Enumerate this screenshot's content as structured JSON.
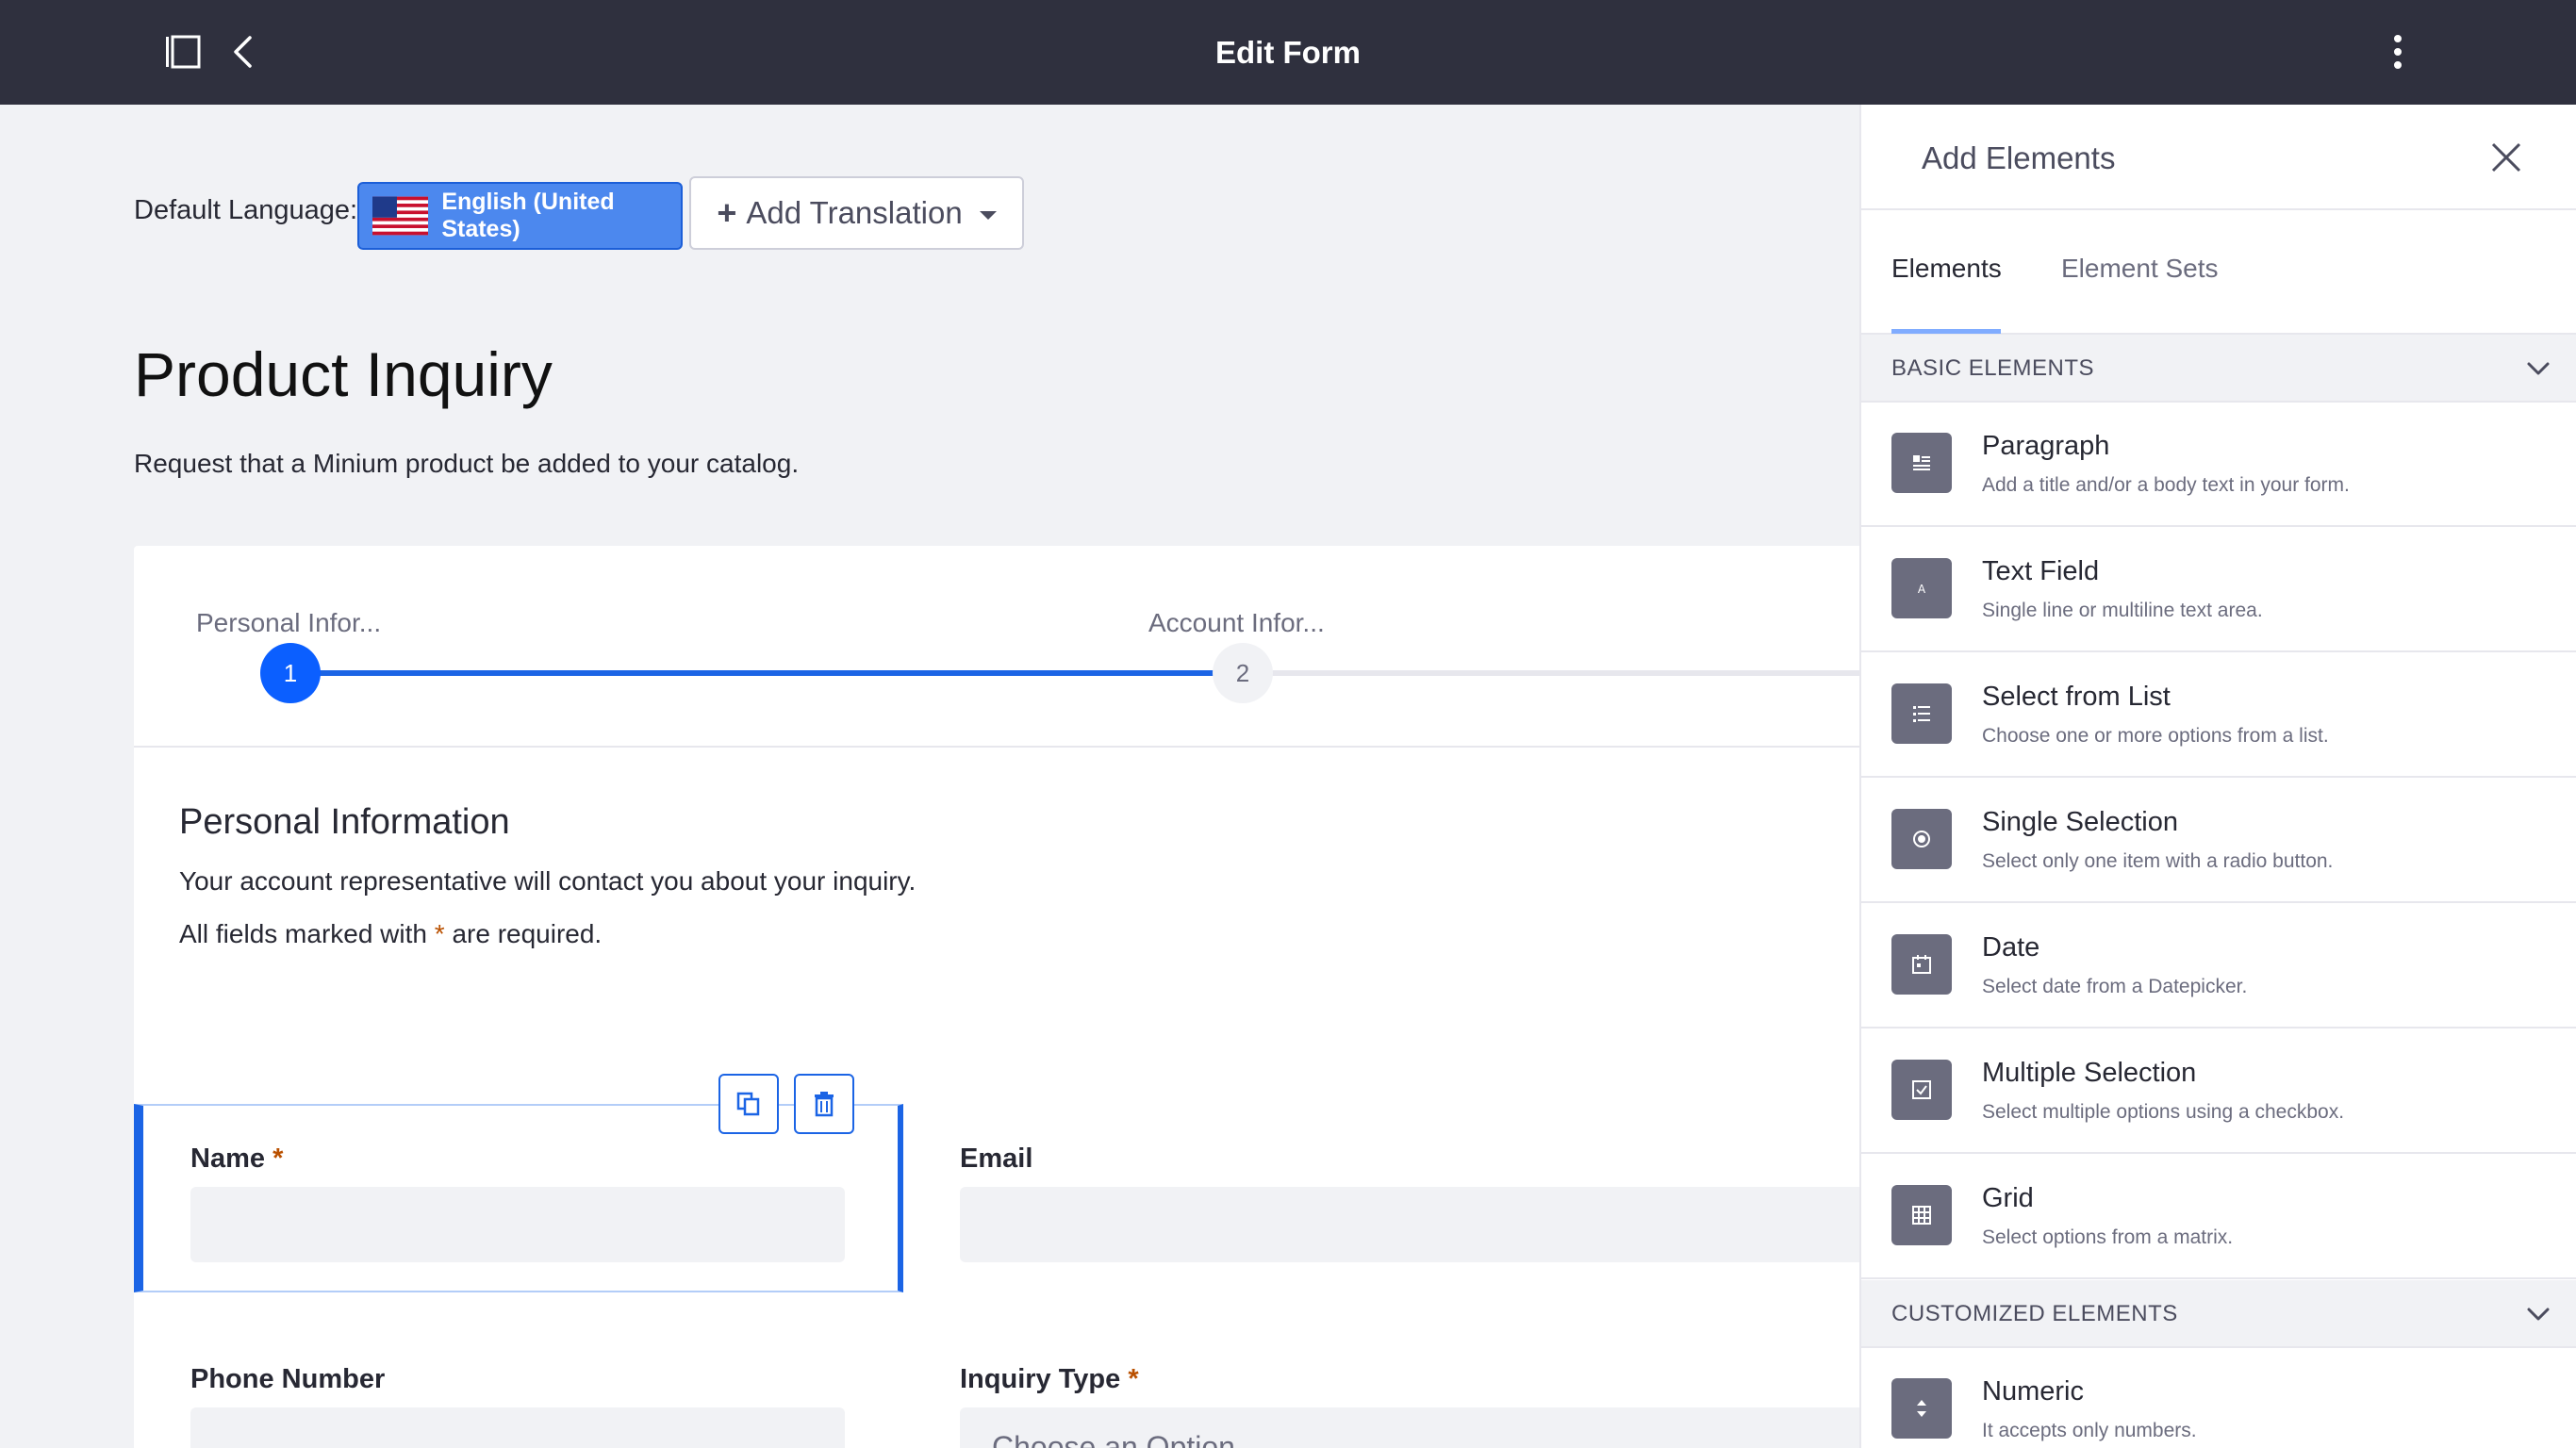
{
  "topbar": {
    "title": "Edit Form",
    "icons": [
      "sidebar-toggle-icon",
      "back-chevron-icon",
      "kebab-menu-icon"
    ]
  },
  "language": {
    "label": "Default Language:",
    "selected": "English (United States)",
    "add_translation": "Add Translation"
  },
  "form": {
    "title": "Product Inquiry",
    "description": "Request that a Minium product be added to your catalog."
  },
  "steps": [
    {
      "number": "1",
      "label": "Personal Infor...",
      "active": true
    },
    {
      "number": "2",
      "label": "Account Infor...",
      "active": false
    }
  ],
  "page": {
    "title": "Personal Information",
    "description": "Your account representative will contact you about your inquiry.",
    "required_prefix": "All fields marked with",
    "required_star": "*",
    "required_suffix": "are required."
  },
  "fields": {
    "name": {
      "label": "Name",
      "star": "*"
    },
    "email": {
      "label": "Email"
    },
    "phone": {
      "label": "Phone Number"
    },
    "inquiry": {
      "label": "Inquiry Type",
      "star": "*",
      "placeholder": "Choose an Option"
    }
  },
  "panel": {
    "title": "Add Elements",
    "tabs": [
      "Elements",
      "Element Sets"
    ],
    "sections": {
      "basic": "BASIC ELEMENTS",
      "custom": "CUSTOMIZED ELEMENTS"
    },
    "elements": [
      {
        "name": "Paragraph",
        "desc": "Add a title and/or a body text in your form.",
        "icon": "paragraph-icon"
      },
      {
        "name": "Text Field",
        "desc": "Single line or multiline text area.",
        "icon": "text-field-icon"
      },
      {
        "name": "Select from List",
        "desc": "Choose one or more options from a list.",
        "icon": "list-icon"
      },
      {
        "name": "Single Selection",
        "desc": "Select only one item with a radio button.",
        "icon": "radio-icon"
      },
      {
        "name": "Date",
        "desc": "Select date from a Datepicker.",
        "icon": "calendar-icon"
      },
      {
        "name": "Multiple Selection",
        "desc": "Select multiple options using a checkbox.",
        "icon": "checkbox-icon"
      },
      {
        "name": "Grid",
        "desc": "Select options from a matrix.",
        "icon": "grid-icon"
      }
    ],
    "custom_elements": [
      {
        "name": "Numeric",
        "desc": "It accepts only numbers.",
        "icon": "numeric-icon"
      }
    ]
  },
  "colors": {
    "topbar": "#2f303e",
    "accent": "#1b64e5",
    "language_button": "#4c88ee",
    "required_star": "#b95000"
  }
}
